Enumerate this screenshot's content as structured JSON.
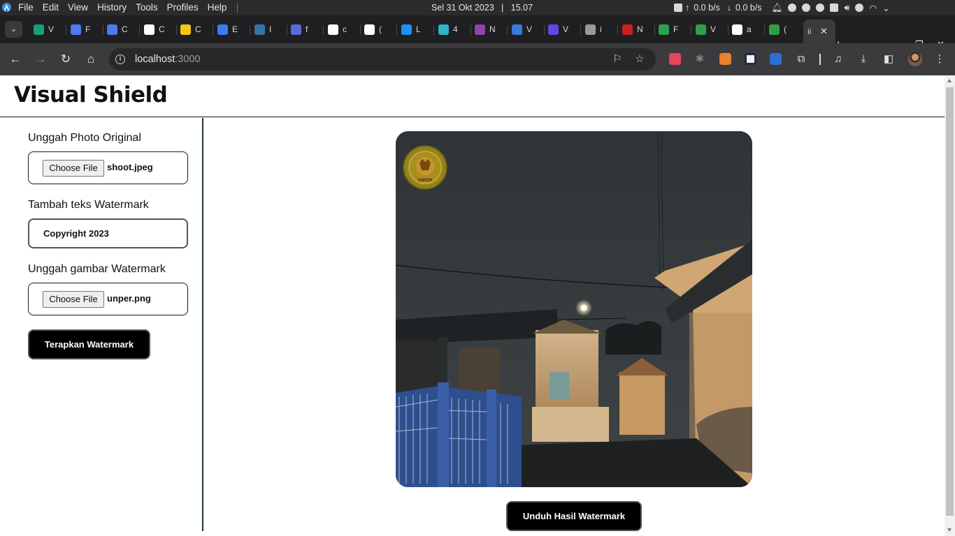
{
  "os_bar": {
    "menu": [
      "File",
      "Edit",
      "View",
      "History",
      "Tools",
      "Profiles",
      "Help"
    ],
    "date": "Sel 31 Okt 2023",
    "time": "15.07",
    "upload_speed": "0.0 b/s",
    "download_speed": "0.0 b/s"
  },
  "tabs": {
    "titles": [
      "V",
      "F",
      "C",
      "C",
      "C",
      "E",
      "I",
      "f",
      "c",
      "(",
      "L",
      "4",
      "N",
      "V",
      "V",
      "i",
      "N",
      "F",
      "V",
      "a",
      "(",
      "ii"
    ],
    "favicon_colors": [
      "#1a9e75",
      "#4b7bec",
      "#4b7bec",
      "#ffffff",
      "#f5c518",
      "#3d7bf2",
      "#3572a5",
      "#5b6bd6",
      "#ffffff",
      "#ffffff",
      "#1e90ff",
      "#2fb3c9",
      "#8e44ad",
      "#3a7bd5",
      "#5b4ae6",
      "#9a9a9a",
      "#cc1f1f",
      "#2e9e4f",
      "#2e9e4f",
      "#ffffff",
      "#2ea043",
      "#ffffff"
    ],
    "active_index": 21
  },
  "toolbar": {
    "url_host": "localhost",
    "url_port": ":3000"
  },
  "page": {
    "title": "Visual Shield",
    "upload_photo_label": "Unggah Photo Original",
    "choose_file_label": "Choose File",
    "photo_file_name": "shoot.jpeg",
    "watermark_text_label": "Tambah teks Watermark",
    "watermark_text_value": "Copyright 2023",
    "upload_watermark_label": "Unggah gambar Watermark",
    "watermark_file_name": "unper.png",
    "apply_button": "Terapkan Watermark",
    "download_button": "Unduh Hasil Watermark",
    "watermark_logo_text": "UNIVERSITAS PERJUANGAN"
  },
  "colors": {
    "os_bar": "#2b2b2e",
    "tab_strip": "#1f1f21",
    "toolbar": "#3b3b3e",
    "button_bg": "#000000",
    "sidebar_divider": "#1f3a2a"
  }
}
